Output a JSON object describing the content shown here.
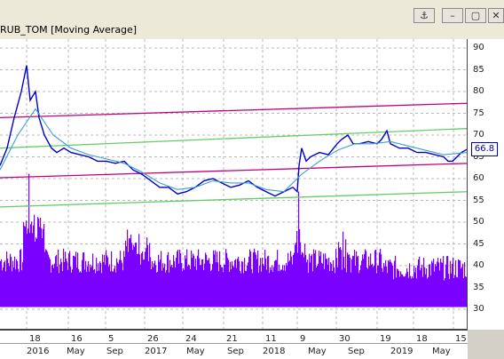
{
  "window": {
    "title": "RUB_TOM [Moving Average]",
    "buttons": {
      "anchor": "⚓",
      "minimize": "–",
      "restore": "▢",
      "close": "✕"
    }
  },
  "chart_data": {
    "type": "line",
    "title": "RUB_TOM [Moving Average]",
    "current_value": "66.8",
    "ylim": [
      28,
      92
    ],
    "y_ticks": [
      "90",
      "85",
      "80",
      "75",
      "70",
      "65",
      "60",
      "55",
      "50",
      "45",
      "40",
      "35",
      "30"
    ],
    "x_ticks_top": [
      "18",
      "16",
      "5",
      "26",
      "24",
      "21",
      "11",
      "9",
      "30",
      "19",
      "18",
      "15"
    ],
    "x_ticks_bottom": [
      "2016",
      "May",
      "Sep",
      "2017",
      "May",
      "Sep",
      "2018",
      "May",
      "Sep",
      "2019",
      "May"
    ],
    "series": [
      {
        "name": "RUB_TOM",
        "points": [
          [
            0,
            63
          ],
          [
            8,
            67
          ],
          [
            16,
            74
          ],
          [
            24,
            80
          ],
          [
            30,
            86
          ],
          [
            34,
            78
          ],
          [
            40,
            80
          ],
          [
            44,
            74
          ],
          [
            50,
            70
          ],
          [
            58,
            67
          ],
          [
            64,
            66
          ],
          [
            72,
            67
          ],
          [
            80,
            66
          ],
          [
            90,
            65.5
          ],
          [
            100,
            65
          ],
          [
            110,
            64
          ],
          [
            120,
            64
          ],
          [
            130,
            63.5
          ],
          [
            140,
            64
          ],
          [
            150,
            62
          ],
          [
            160,
            61
          ],
          [
            170,
            59.5
          ],
          [
            180,
            58
          ],
          [
            190,
            58
          ],
          [
            200,
            56.5
          ],
          [
            210,
            57
          ],
          [
            220,
            58
          ],
          [
            230,
            59.5
          ],
          [
            240,
            60
          ],
          [
            250,
            59
          ],
          [
            260,
            58
          ],
          [
            270,
            58.5
          ],
          [
            280,
            59.5
          ],
          [
            290,
            58
          ],
          [
            300,
            57
          ],
          [
            310,
            56
          ],
          [
            320,
            57
          ],
          [
            330,
            58
          ],
          [
            335,
            57
          ],
          [
            337,
            63
          ],
          [
            340,
            67
          ],
          [
            345,
            64
          ],
          [
            350,
            65
          ],
          [
            360,
            66
          ],
          [
            370,
            65.5
          ],
          [
            380,
            68
          ],
          [
            385,
            69
          ],
          [
            392,
            70
          ],
          [
            398,
            68
          ],
          [
            405,
            68
          ],
          [
            415,
            68.5
          ],
          [
            425,
            68
          ],
          [
            430,
            69
          ],
          [
            436,
            71
          ],
          [
            440,
            68
          ],
          [
            450,
            67
          ],
          [
            460,
            67
          ],
          [
            470,
            66
          ],
          [
            480,
            66
          ],
          [
            490,
            65.5
          ],
          [
            500,
            65
          ],
          [
            505,
            64
          ],
          [
            510,
            64
          ],
          [
            515,
            65
          ],
          [
            520,
            66
          ],
          [
            527,
            66.8
          ]
        ],
        "color": "#0000c8"
      },
      {
        "name": "Moving Average",
        "points": [
          [
            0,
            62
          ],
          [
            20,
            70
          ],
          [
            40,
            76
          ],
          [
            60,
            70
          ],
          [
            80,
            67
          ],
          [
            100,
            65.5
          ],
          [
            120,
            64.5
          ],
          [
            140,
            63.5
          ],
          [
            160,
            61.5
          ],
          [
            180,
            59
          ],
          [
            200,
            57.5
          ],
          [
            220,
            58
          ],
          [
            240,
            59.5
          ],
          [
            260,
            59
          ],
          [
            280,
            59
          ],
          [
            300,
            57.5
          ],
          [
            320,
            57
          ],
          [
            340,
            61
          ],
          [
            360,
            64
          ],
          [
            380,
            66.5
          ],
          [
            400,
            68
          ],
          [
            420,
            68
          ],
          [
            440,
            68.5
          ],
          [
            460,
            67.5
          ],
          [
            480,
            66.5
          ],
          [
            500,
            65.5
          ],
          [
            527,
            66
          ]
        ],
        "color": "#3aa0d0"
      }
    ],
    "trendlines": [
      {
        "from": [
          0,
          74
        ],
        "to": [
          527,
          77.3
        ],
        "color": "#c00080"
      },
      {
        "from": [
          0,
          67
        ],
        "to": [
          527,
          71.5
        ],
        "color": "#66cc66"
      },
      {
        "from": [
          0,
          60.2
        ],
        "to": [
          527,
          63.5
        ],
        "color": "#c00080"
      },
      {
        "from": [
          0,
          53.5
        ],
        "to": [
          527,
          57
        ],
        "color": "#66cc66"
      }
    ],
    "volume_color": "#7a00ff",
    "grid": true
  }
}
